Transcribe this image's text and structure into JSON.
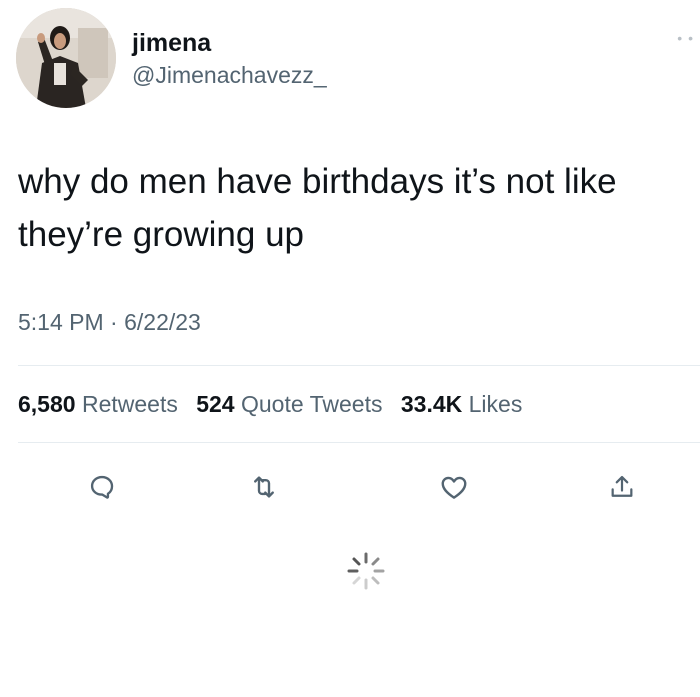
{
  "user": {
    "display_name": "jimena",
    "handle": "@Jimenachavezz_"
  },
  "tweet": {
    "text": "why do men have birthdays it’s not like they’re growing up",
    "timestamp": "5:14 PM · 6/22/23"
  },
  "stats": {
    "retweets_count": "6,580",
    "retweets_label": "Retweets",
    "quotes_count": "524",
    "quotes_label": "Quote Tweets",
    "likes_count": "33.4K",
    "likes_label": "Likes"
  },
  "actions": {
    "reply_icon": "reply-icon",
    "retweet_icon": "retweet-icon",
    "like_icon": "heart-icon",
    "share_icon": "share-icon"
  },
  "colors": {
    "text_primary": "#0f1419",
    "text_secondary": "#536471",
    "divider": "#e6ecf0"
  }
}
